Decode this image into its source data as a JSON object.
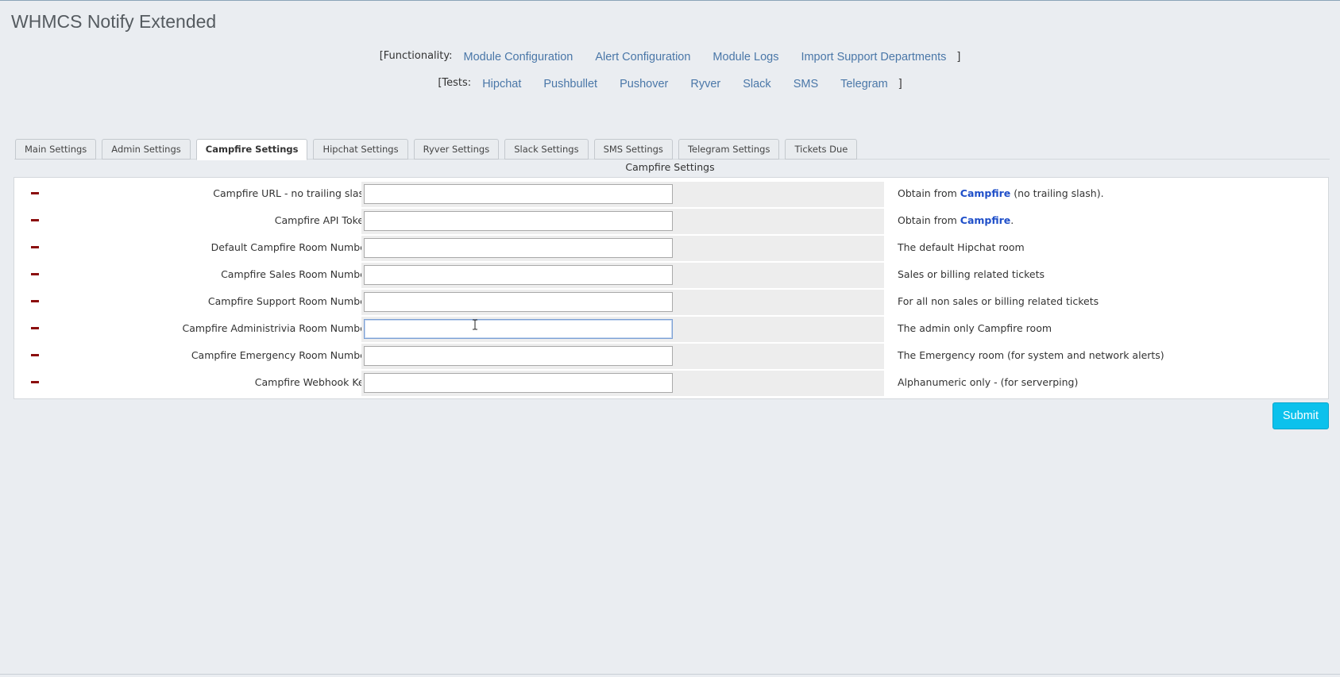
{
  "page": {
    "title": "WHMCS Notify Extended"
  },
  "functionality": {
    "prefix": "[Functionality:",
    "links": [
      "Module Configuration",
      "Alert Configuration",
      "Module Logs",
      "Import Support Departments"
    ],
    "suffix": "]"
  },
  "tests": {
    "prefix": "[Tests:",
    "links": [
      "Hipchat",
      "Pushbullet",
      "Pushover",
      "Ryver",
      "Slack",
      "SMS",
      "Telegram"
    ],
    "suffix": "]"
  },
  "tabs": [
    {
      "label": "Main Settings",
      "active": false
    },
    {
      "label": "Admin Settings",
      "active": false
    },
    {
      "label": "Campfire Settings",
      "active": true
    },
    {
      "label": "Hipchat Settings",
      "active": false
    },
    {
      "label": "Ryver Settings",
      "active": false
    },
    {
      "label": "Slack Settings",
      "active": false
    },
    {
      "label": "SMS Settings",
      "active": false
    },
    {
      "label": "Telegram Settings",
      "active": false
    },
    {
      "label": "Tickets Due",
      "active": false
    }
  ],
  "section": {
    "title": "Campfire Settings"
  },
  "settings": [
    {
      "label": "Campfire URL - no trailing slash",
      "value": "",
      "help_pre": "Obtain from ",
      "help_link": "Campfire",
      "help_post": " (no trailing slash)."
    },
    {
      "label": "Campfire API Token",
      "value": "",
      "help_pre": "Obtain from ",
      "help_link": "Campfire",
      "help_post": "."
    },
    {
      "label": "Default Campfire Room Number",
      "value": "",
      "help_pre": "The default Hipchat room",
      "help_link": "",
      "help_post": ""
    },
    {
      "label": "Campfire Sales Room Number",
      "value": "",
      "help_pre": "Sales or billing related tickets",
      "help_link": "",
      "help_post": ""
    },
    {
      "label": "Campfire Support Room Number",
      "value": "",
      "help_pre": "For all non sales or billing related tickets",
      "help_link": "",
      "help_post": ""
    },
    {
      "label": "Campfire Administrivia Room Number",
      "value": "",
      "help_pre": "The admin only Campfire room",
      "help_link": "",
      "help_post": ""
    },
    {
      "label": "Campfire Emergency Room Number",
      "value": "",
      "help_pre": "The Emergency room (for system and network alerts)",
      "help_link": "",
      "help_post": ""
    },
    {
      "label": "Campfire Webhook Key",
      "value": "",
      "help_pre": "Alphanumeric only - (for serverping)",
      "help_link": "",
      "help_post": ""
    }
  ],
  "focused_field": "Campfire Administrivia Room Number",
  "submit": {
    "label": "Submit"
  },
  "colors": {
    "accent": "#0cc1ec",
    "link": "#4a77a8",
    "help_link": "#1f4fc9",
    "remove": "#8b0d0d"
  },
  "icons": {
    "row_action": "minus-icon",
    "cursor": "text-cursor-icon"
  }
}
